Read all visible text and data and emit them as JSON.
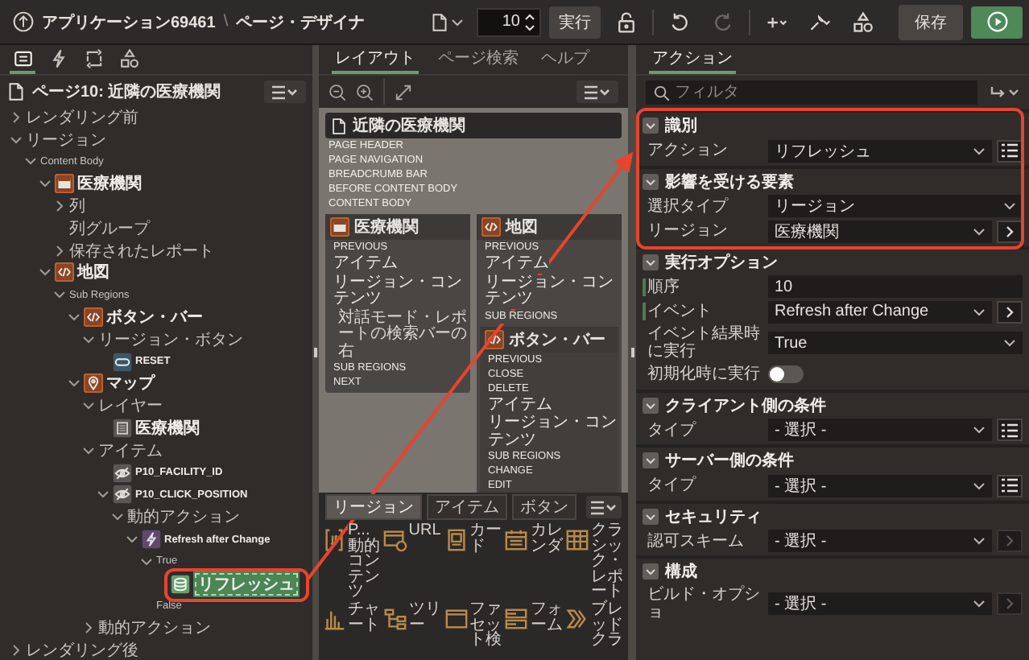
{
  "top_bar": {
    "app": "アプリケーション69461",
    "separator": "\\",
    "page": "ページ・デザイナ",
    "page_number": "10",
    "go": "実行",
    "tools": [
      {
        "kind": "lock",
        "disabled": false
      },
      {
        "kind": "undo",
        "disabled": false
      },
      {
        "kind": "redo",
        "disabled": true
      },
      {
        "kind": "add",
        "disabled": false
      },
      {
        "kind": "utilities",
        "disabled": false
      },
      {
        "kind": "shared",
        "disabled": false
      }
    ],
    "save": "保存"
  },
  "left_panel": {
    "tabs": [
      {
        "kind": "rendering",
        "selected": true
      },
      {
        "kind": "dynamic",
        "selected": false
      },
      {
        "kind": "processing",
        "selected": false
      },
      {
        "kind": "shared",
        "selected": false
      }
    ],
    "page_title": "ページ10: 近隣の医療機関",
    "tree": [
      {
        "label": "レンダリング前",
        "expanded": false,
        "selected": false
      },
      {
        "label": "リージョン",
        "expanded": true,
        "selected": false,
        "children": [
          {
            "label": "Content Body",
            "expanded": true,
            "selected": false,
            "children": [
              {
                "label": "医療機関",
                "kind": "region",
                "expanded": true,
                "selected": false,
                "children": [
                  {
                    "label": "列",
                    "expanded": false,
                    "selected": false
                  },
                  {
                    "label": "列グループ",
                    "selected": false
                  },
                  {
                    "label": "保存されたレポート",
                    "expanded": false,
                    "selected": false
                  }
                ]
              },
              {
                "label": "地図",
                "kind": "code",
                "expanded": true,
                "selected": false,
                "children": [
                  {
                    "label": "Sub Regions",
                    "expanded": true,
                    "selected": false,
                    "children": [
                      {
                        "label": "ボタン・バー",
                        "kind": "code",
                        "expanded": true,
                        "selected": false,
                        "children": [
                          {
                            "label": "リージョン・ボタン",
                            "expanded": true,
                            "selected": false,
                            "children": [
                              {
                                "label": "RESET",
                                "kind": "button",
                                "selected": false
                              }
                            ]
                          }
                        ]
                      },
                      {
                        "label": "マップ",
                        "kind": "map",
                        "expanded": true,
                        "selected": false,
                        "children": [
                          {
                            "label": "レイヤー",
                            "expanded": true,
                            "selected": false,
                            "children": [
                              {
                                "label": "医療機関",
                                "kind": "layer",
                                "selected": false
                              }
                            ]
                          },
                          {
                            "label": "アイテム",
                            "expanded": true,
                            "selected": false,
                            "children": [
                              {
                                "label": "P10_FACILITY_ID",
                                "kind": "hidden",
                                "selected": false
                              },
                              {
                                "label": "P10_CLICK_POSITION",
                                "kind": "hidden",
                                "expanded": true,
                                "selected": false,
                                "children": [
                                  {
                                    "label": "動的アクション",
                                    "expanded": true,
                                    "selected": false,
                                    "children": [
                                      {
                                        "label": "Refresh after Change",
                                        "kind": "lightning",
                                        "expanded": true,
                                        "selected": false,
                                        "children": [
                                          {
                                            "label": "True",
                                            "expanded": true,
                                            "selected": false,
                                            "children": [
                                              {
                                                "label": "リフレッシュ",
                                                "kind": "action",
                                                "selected": true
                                              }
                                            ]
                                          },
                                          {
                                            "label": "False",
                                            "selected": false
                                          }
                                        ]
                                      }
                                    ]
                                  }
                                ]
                              }
                            ]
                          },
                          {
                            "label": "動的アクション",
                            "expanded": false,
                            "selected": false
                          }
                        ]
                      }
                    ]
                  }
                ]
              }
            ]
          }
        ]
      },
      {
        "label": "レンダリング後",
        "expanded": false,
        "selected": false
      }
    ]
  },
  "middle_panel": {
    "tabs": [
      {
        "label": "レイアウト",
        "selected": true
      },
      {
        "label": "ページ検索",
        "selected": false
      },
      {
        "label": "ヘルプ",
        "selected": false
      }
    ],
    "canvas": {
      "page_title": "近隣の医療機関",
      "slots": [
        "PAGE HEADER",
        "PAGE NAVIGATION",
        "BREADCRUMB BAR",
        "BEFORE CONTENT BODY",
        "CONTENT BODY"
      ],
      "regions": [
        {
          "title": "医療機関",
          "kind": "region",
          "items": [
            {
              "kind": "slot",
              "label": "PREVIOUS"
            },
            {
              "kind": "slot",
              "label": "アイテム"
            },
            {
              "kind": "slot",
              "label": "リージョン・コンテンツ"
            },
            {
              "kind": "note",
              "label": "対話モード・レポートの検索バーの右"
            },
            {
              "kind": "slot",
              "label": "SUB REGIONS"
            },
            {
              "kind": "slot",
              "label": "NEXT"
            }
          ]
        },
        {
          "title": "地図",
          "kind": "code",
          "items": [
            {
              "kind": "slot",
              "label": "PREVIOUS"
            },
            {
              "kind": "slot",
              "label": "アイテム"
            },
            {
              "kind": "slot",
              "label": "リージョン・コンテンツ"
            },
            {
              "kind": "slot",
              "label": "SUB REGIONS"
            }
          ],
          "sub_regions": [
            {
              "title": "ボタン・バー",
              "kind": "code",
              "items": [
                {
                  "kind": "slot",
                  "label": "PREVIOUS"
                },
                {
                  "kind": "slot",
                  "label": "CLOSE"
                },
                {
                  "kind": "slot",
                  "label": "DELETE"
                },
                {
                  "kind": "slot",
                  "label": "アイテム"
                },
                {
                  "kind": "slot",
                  "label": "リージョン・コンテンツ"
                },
                {
                  "kind": "slot",
                  "label": "SUB REGIONS"
                },
                {
                  "kind": "slot",
                  "label": "CHANGE"
                },
                {
                  "kind": "slot",
                  "label": "EDIT"
                }
              ]
            }
          ]
        }
      ]
    },
    "gallery": {
      "tabs": [
        {
          "label": "リージョン",
          "selected": true
        },
        {
          "label": "アイテム",
          "selected": false
        },
        {
          "label": "ボタン",
          "selected": false
        }
      ],
      "items": [
        {
          "label": "P...動的コンテンツ",
          "kind": "dynamic"
        },
        {
          "label": "URL",
          "kind": "url"
        },
        {
          "label": "カード",
          "kind": "cards"
        },
        {
          "label": "カレンダ",
          "kind": "calendar"
        },
        {
          "label": "クラシック・レポート",
          "kind": "report"
        },
        {
          "label": "チャート",
          "kind": "chart"
        },
        {
          "label": "ツリー",
          "kind": "tree"
        },
        {
          "label": "ファセット検",
          "kind": "facet"
        },
        {
          "label": "フォーム",
          "kind": "form"
        },
        {
          "label": "ブレッドクラ",
          "kind": "breadcrumb"
        }
      ]
    }
  },
  "right_panel": {
    "tabs": [
      {
        "label": "アクション",
        "selected": true
      }
    ],
    "filter_placeholder": "フィルタ",
    "sections": [
      {
        "title": "識別",
        "expanded": true,
        "fields": [
          {
            "label": "アクション",
            "kind": "select",
            "value": "リフレッシュ",
            "button": {
              "kind": "list",
              "disabled": false
            },
            "required": false
          }
        ]
      },
      {
        "title": "影響を受ける要素",
        "expanded": true,
        "fields": [
          {
            "label": "選択タイプ",
            "kind": "select",
            "value": "リージョン",
            "required": false
          },
          {
            "label": "リージョン",
            "kind": "select",
            "value": "医療機関",
            "button": {
              "kind": "arrow",
              "disabled": false
            },
            "required": false
          }
        ]
      },
      {
        "title": "実行オプション",
        "expanded": true,
        "fields": [
          {
            "label": "順序",
            "kind": "input",
            "value": "10",
            "required": true
          },
          {
            "label": "イベント",
            "kind": "select",
            "value": "Refresh after Change",
            "button": {
              "kind": "arrow",
              "disabled": false
            },
            "required": true
          },
          {
            "label": "イベント結果時に実行",
            "kind": "select",
            "value": "True",
            "required": false
          },
          {
            "label": "初期化時に実行",
            "kind": "toggle",
            "on": false,
            "required": false
          }
        ]
      },
      {
        "title": "クライアント側の条件",
        "expanded": true,
        "fields": [
          {
            "label": "タイプ",
            "kind": "select",
            "value": "- 選択 -",
            "button": {
              "kind": "list",
              "disabled": false
            },
            "required": false
          }
        ]
      },
      {
        "title": "サーバー側の条件",
        "expanded": true,
        "fields": [
          {
            "label": "タイプ",
            "kind": "select",
            "value": "- 選択 -",
            "button": {
              "kind": "list",
              "disabled": false
            },
            "required": false
          }
        ]
      },
      {
        "title": "セキュリティ",
        "expanded": true,
        "fields": [
          {
            "label": "認可スキーム",
            "kind": "select",
            "value": "- 選択 -",
            "button": {
              "kind": "arrow",
              "disabled": true
            },
            "required": false
          }
        ]
      },
      {
        "title": "構成",
        "expanded": true,
        "fields": [
          {
            "label": "ビルド・オプショ",
            "kind": "select",
            "value": "- 選択 -",
            "button": {
              "kind": "arrow",
              "disabled": true
            },
            "required": false
          }
        ]
      }
    ]
  }
}
